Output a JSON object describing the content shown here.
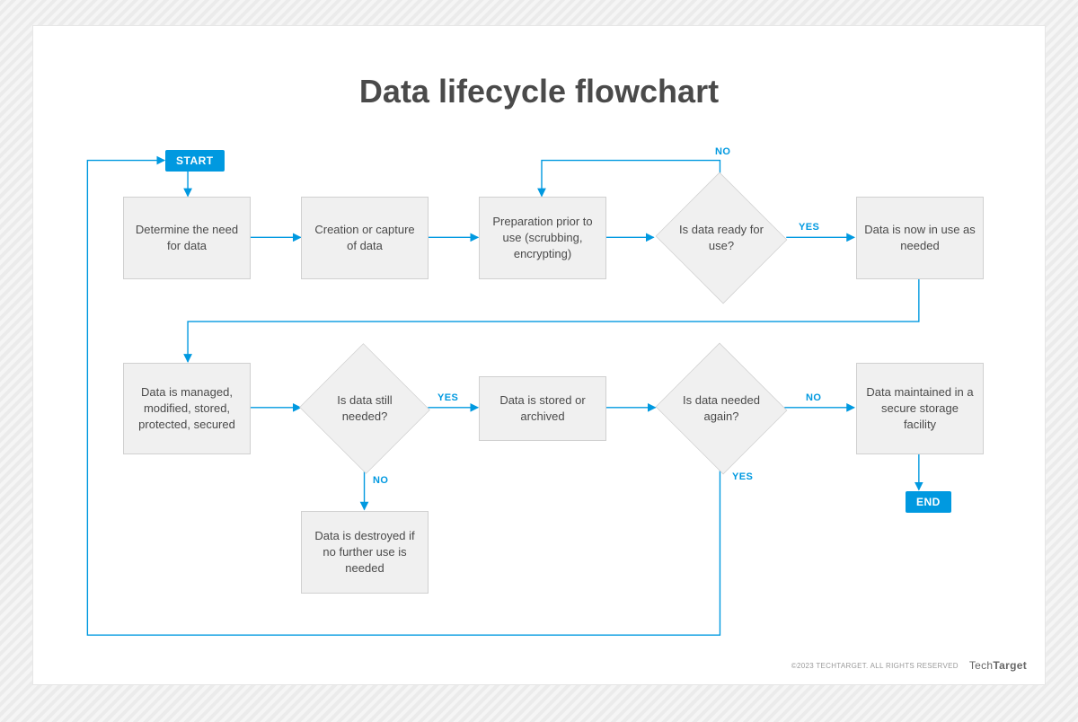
{
  "title": "Data lifecycle flowchart",
  "nodes": {
    "start": "START",
    "need": "Determine the need for data",
    "creation": "Creation or capture of data",
    "prep": "Preparation prior to use (scrubbing, encrypting)",
    "readyQ": "Is data ready for use?",
    "inUse": "Data is now in use as needed",
    "managed": "Data is managed, modified, stored, protected, secured",
    "stillQ": "Is data still needed?",
    "destroyed": "Data is destroyed if no further use is needed",
    "archived": "Data is stored or archived",
    "againQ": "Is data needed again?",
    "maintained": "Data maintained in a secure storage facility",
    "end": "END"
  },
  "labels": {
    "yes": "YES",
    "no": "NO"
  },
  "footer": {
    "copyright": "©2023 TECHTARGET. ALL RIGHTS RESERVED",
    "brandLight": "Tech",
    "brandBold": "Target"
  },
  "colors": {
    "accent": "#0099e0",
    "nodeFill": "#f0f0f0",
    "nodeStroke": "#d0d0d0"
  }
}
